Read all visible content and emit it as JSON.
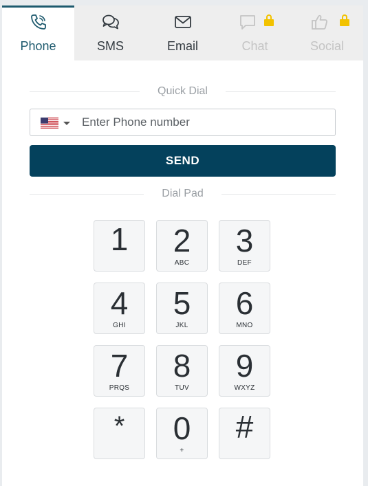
{
  "tabs": [
    {
      "label": "Phone",
      "icon": "phone-icon",
      "active": true,
      "locked": false
    },
    {
      "label": "SMS",
      "icon": "chat-bubbles-icon",
      "active": false,
      "locked": false
    },
    {
      "label": "Email",
      "icon": "envelope-icon",
      "active": false,
      "locked": false
    },
    {
      "label": "Chat",
      "icon": "chat-bubble-icon",
      "active": false,
      "locked": true
    },
    {
      "label": "Social",
      "icon": "thumbs-up-icon",
      "active": false,
      "locked": true
    }
  ],
  "quick_dial": {
    "heading": "Quick Dial",
    "country_flag": "us-flag-icon",
    "phone_placeholder": "Enter Phone number",
    "phone_value": "",
    "send_label": "SEND"
  },
  "dial_pad": {
    "heading": "Dial Pad",
    "keys": [
      {
        "digit": "1",
        "letters": ""
      },
      {
        "digit": "2",
        "letters": "ABC"
      },
      {
        "digit": "3",
        "letters": "DEF"
      },
      {
        "digit": "4",
        "letters": "GHI"
      },
      {
        "digit": "5",
        "letters": "JKL"
      },
      {
        "digit": "6",
        "letters": "MNO"
      },
      {
        "digit": "7",
        "letters": "PRQS"
      },
      {
        "digit": "8",
        "letters": "TUV"
      },
      {
        "digit": "9",
        "letters": "WXYZ"
      },
      {
        "digit": "*",
        "letters": ""
      },
      {
        "digit": "0",
        "letters": "+"
      },
      {
        "digit": "#",
        "letters": ""
      }
    ]
  },
  "colors": {
    "accent": "#1e5a6e",
    "send_button": "#04415c",
    "lock": "#f2c200",
    "tab_bar": "#eeeeee"
  }
}
